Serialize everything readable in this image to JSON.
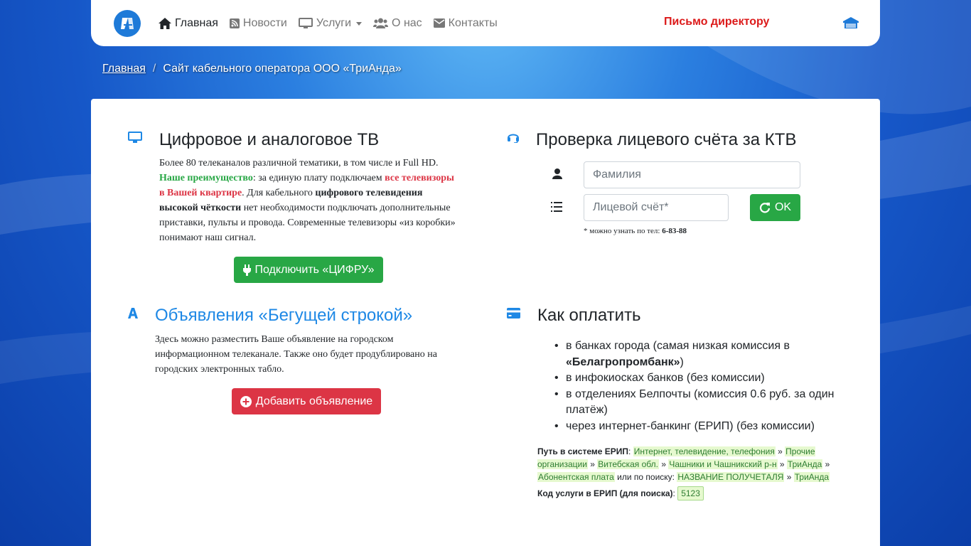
{
  "nav": {
    "items": [
      {
        "label": "Главная",
        "icon": "home-icon"
      },
      {
        "label": "Новости",
        "icon": "rss-icon"
      },
      {
        "label": "Услуги",
        "icon": "desktop-icon"
      },
      {
        "label": "О нас",
        "icon": "users-icon"
      },
      {
        "label": "Контакты",
        "icon": "envelope-icon"
      }
    ],
    "director_link": "Письмо директору"
  },
  "breadcrumb": {
    "home": "Главная",
    "current": "Сайт кабельного оператора ООО «ТриАнда»"
  },
  "tv": {
    "title": "Цифровое и аналоговое ТВ",
    "p1": "Более 80 телеканалов различной тематики, в том числе и Full HD.",
    "adv_label": "Наше преимущество",
    "adv_text": ": за единую плату подключаем ",
    "adv_red": "все телевизоры в Вашей квартире",
    "adv_text2": ". Для кабельного ",
    "adv_bold": "цифрового телевидения высокой чёткости",
    "adv_text3": " нет необходимости подключать дополнительные приставки, пульты и провода. Современные телевизоры «из коробки» понимают наш сигнал.",
    "button": "Подключить «ЦИФРУ»"
  },
  "ads": {
    "title": "Объявления «Бегущей строкой»",
    "text": "Здесь можно разместить Ваше объявление на городском информационном телеканале. Также оно будет продублировано на городских электронных табло.",
    "button": "Добавить объявление"
  },
  "account": {
    "title": "Проверка лицевого счёта за КТВ",
    "surname_placeholder": "Фамилия",
    "account_placeholder": "Лицевой счёт*",
    "ok_button": "OK",
    "note_prefix": "* можно узнать по тел: ",
    "note_phone": "6-83-88"
  },
  "payment": {
    "title": "Как оплатить",
    "items": [
      {
        "text": "в банках города (самая низкая комиссия в ",
        "bold": "«Белагропромбанк»",
        "tail": ")"
      },
      {
        "text": "в инфокиосках банков (без комиссии)"
      },
      {
        "text": "в отделениях Белпочты (комиссия 0.6 руб. за один платёж)"
      },
      {
        "text": "через интернет-банкинг (ЕРИП) (без комиссии)"
      }
    ],
    "erip_label": "Путь в системе ЕРИП",
    "erip_path": [
      "Интернет, телевидение, телефония",
      "Прочие организации",
      "Витебская обл.",
      "Чашники и Чашникский р-н",
      "ТриАнда",
      "Абонентская плата"
    ],
    "erip_or": " или по поиску: ",
    "erip_search": [
      "НАЗВАНИЕ ПОЛУЧЕТАЛЯ",
      "ТриАнда"
    ],
    "code_label": "Код услуги в ЕРИП (для поиска)",
    "code": "5123"
  },
  "colors": {
    "accent_blue": "#1e88e5",
    "green": "#28a745",
    "red": "#dc3545",
    "director_red": "#dc1a1a"
  }
}
